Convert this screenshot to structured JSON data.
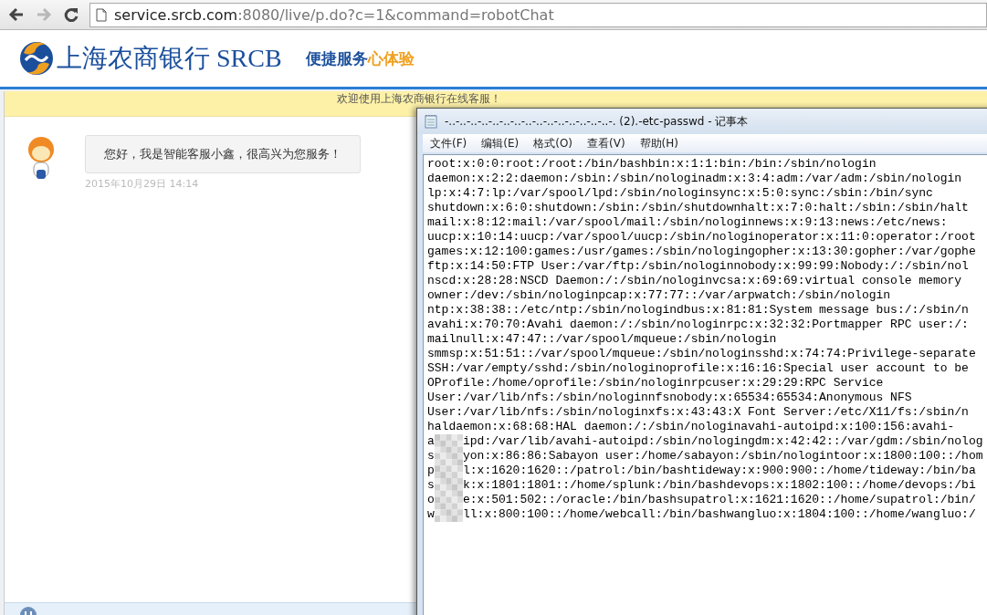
{
  "browser": {
    "navigation": [
      {
        "kind": "back",
        "disabled": false
      },
      {
        "kind": "forward",
        "disabled": true
      },
      {
        "kind": "reload",
        "disabled": false
      }
    ],
    "address": {
      "host": "service.srcb.com",
      "rest": ":8080/live/p.do?c=1&command=robotChat"
    }
  },
  "header": {
    "bank_name": "上海农商银行 SRCB",
    "slogan_main": "便捷服务",
    "slogan_accent": "心体验"
  },
  "chat": {
    "banner": "欢迎使用上海农商银行在线客服！",
    "messages": [
      {
        "text": "您好，我是智能客服小鑫，很高兴为您服务！",
        "time": "2015年10月29日  14:14"
      }
    ]
  },
  "notepad": {
    "title": "-..-..-..-..-..-..-..-..-..-..-..-..-..-..-..-. (2).-etc-passwd - 记事本",
    "menu": [
      "文件(F)",
      "编辑(E)",
      "格式(O)",
      "查看(V)",
      "帮助(H)"
    ],
    "lines": [
      {
        "kind": "plain",
        "text": "root:x:0:0:root:/root:/bin/bashbin:x:1:1:bin:/bin:/sbin/nologin"
      },
      {
        "kind": "plain",
        "text": "daemon:x:2:2:daemon:/sbin:/sbin/nologinadm:x:3:4:adm:/var/adm:/sbin/nologin"
      },
      {
        "kind": "plain",
        "text": "lp:x:4:7:lp:/var/spool/lpd:/sbin/nologinsync:x:5:0:sync:/sbin:/bin/sync"
      },
      {
        "kind": "plain",
        "text": "shutdown:x:6:0:shutdown:/sbin:/sbin/shutdownhalt:x:7:0:halt:/sbin:/sbin/halt"
      },
      {
        "kind": "plain",
        "text": "mail:x:8:12:mail:/var/spool/mail:/sbin/nologinnews:x:9:13:news:/etc/news:"
      },
      {
        "kind": "plain",
        "text": "uucp:x:10:14:uucp:/var/spool/uucp:/sbin/nologinoperator:x:11:0:operator:/root"
      },
      {
        "kind": "plain",
        "text": "games:x:12:100:games:/usr/games:/sbin/nologingopher:x:13:30:gopher:/var/gophe"
      },
      {
        "kind": "plain",
        "text": "ftp:x:14:50:FTP User:/var/ftp:/sbin/nologinnobody:x:99:99:Nobody:/:/sbin/nol"
      },
      {
        "kind": "plain",
        "text": "nscd:x:28:28:NSCD Daemon:/:/sbin/nologinvcsa:x:69:69:virtual console memory"
      },
      {
        "kind": "plain",
        "text": "owner:/dev:/sbin/nologinpcap:x:77:77::/var/arpwatch:/sbin/nologin"
      },
      {
        "kind": "plain",
        "text": "ntp:x:38:38::/etc/ntp:/sbin/nologindbus:x:81:81:System message bus:/:/sbin/n"
      },
      {
        "kind": "plain",
        "text": "avahi:x:70:70:Avahi daemon:/:/sbin/nologinrpc:x:32:32:Portmapper RPC user:/:"
      },
      {
        "kind": "plain",
        "text": "mailnull:x:47:47::/var/spool/mqueue:/sbin/nologin"
      },
      {
        "kind": "plain",
        "text": "smmsp:x:51:51::/var/spool/mqueue:/sbin/nologinsshd:x:74:74:Privilege-separate"
      },
      {
        "kind": "plain",
        "text": "SSH:/var/empty/sshd:/sbin/nologinoprofile:x:16:16:Special user account to be"
      },
      {
        "kind": "plain",
        "text": "OProfile:/home/oprofile:/sbin/nologinrpcuser:x:29:29:RPC Service"
      },
      {
        "kind": "plain",
        "text": "User:/var/lib/nfs:/sbin/nologinnfsnobody:x:65534:65534:Anonymous NFS"
      },
      {
        "kind": "plain",
        "text": "User:/var/lib/nfs:/sbin/nologinxfs:x:43:43:X Font Server:/etc/X11/fs:/sbin/n"
      },
      {
        "kind": "plain",
        "text": "haldaemon:x:68:68:HAL daemon:/:/sbin/nologinavahi-autoipd:x:100:156:avahi-"
      },
      {
        "kind": "redacted",
        "head": "a",
        "tail": "ipd:/var/lib/avahi-autoipd:/sbin/nologingdm:x:42:42::/var/gdm:/sbin/nolog"
      },
      {
        "kind": "redacted",
        "head": "s",
        "tail": "yon:x:86:86:Sabayon user:/home/sabayon:/sbin/nologintoor:x:1800:100::/hom"
      },
      {
        "kind": "redacted",
        "head": "p",
        "tail": "l:x:1620:1620::/patrol:/bin/bashtideway:x:900:900::/home/tideway:/bin/ba"
      },
      {
        "kind": "redacted",
        "head": "s",
        "tail": "k:x:1801:1801::/home/splunk:/bin/bashdevops:x:1802:100::/home/devops:/bi"
      },
      {
        "kind": "redacted",
        "head": "o",
        "tail": "e:x:501:502::/oracle:/bin/bashsupatrol:x:1621:1620::/home/supatrol:/bin/"
      },
      {
        "kind": "redacted",
        "head": "w",
        "tail": "ll:x:800:100::/home/webcall:/bin/bashwangluo:x:1804:100::/home/wangluo:/"
      }
    ]
  }
}
